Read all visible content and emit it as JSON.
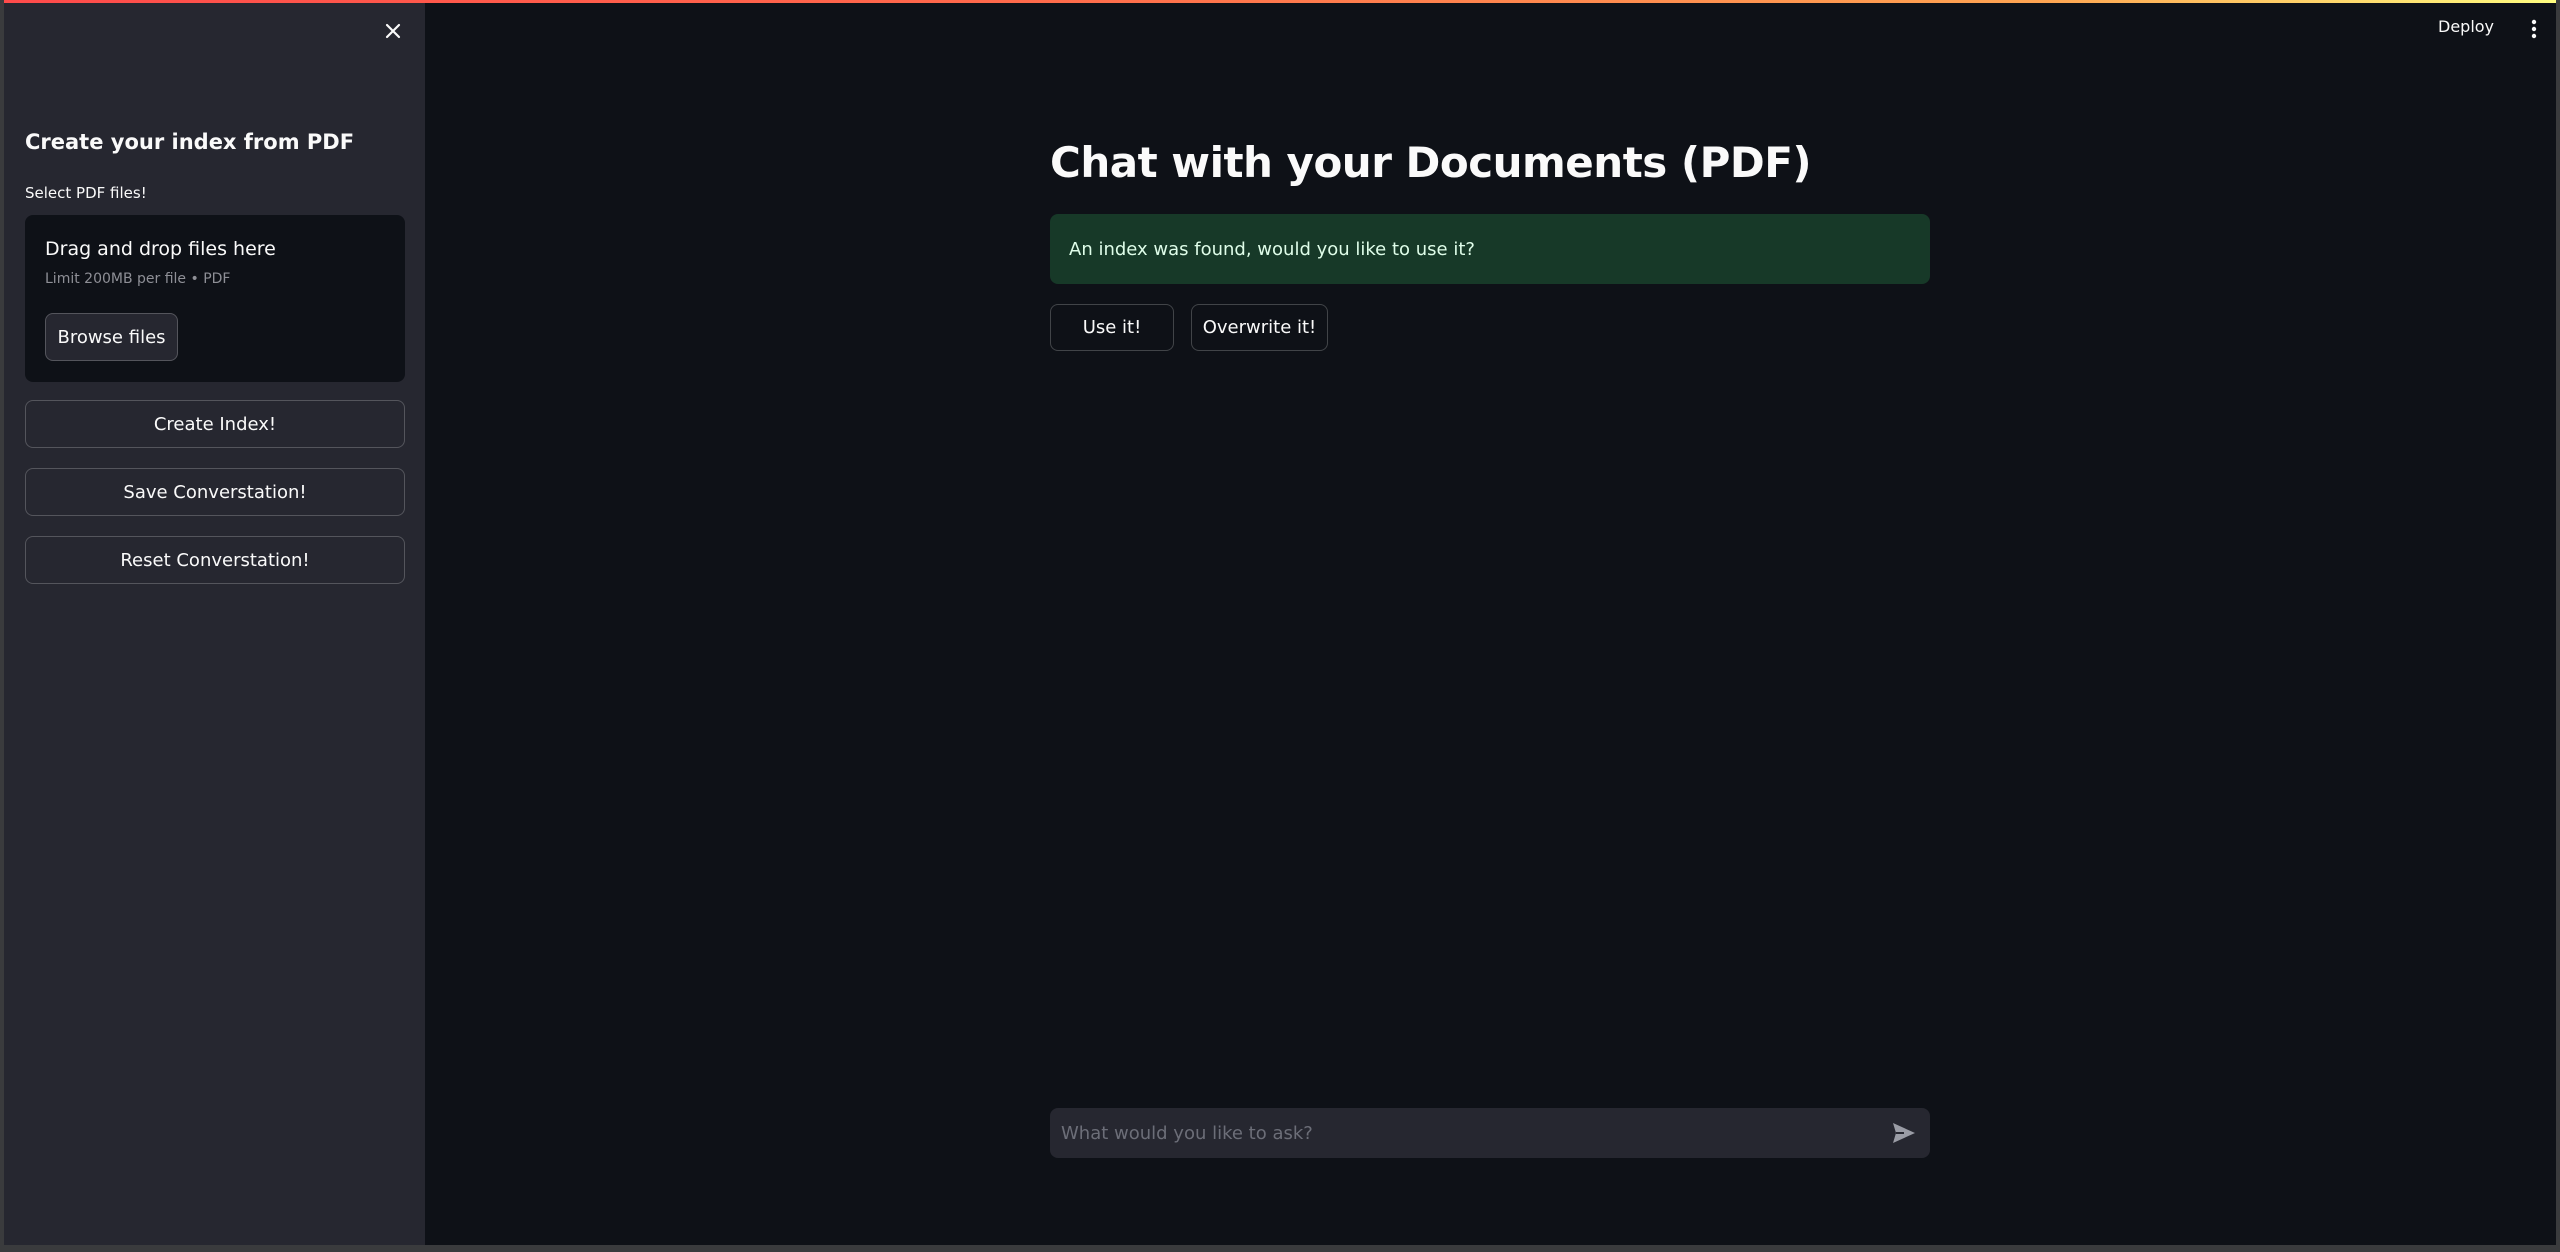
{
  "header": {
    "deploy_label": "Deploy"
  },
  "sidebar": {
    "title": "Create your index from PDF",
    "uploader_label": "Select PDF files!",
    "dropzone": {
      "title": "Drag and drop files here",
      "limit": "Limit 200MB per file • PDF",
      "browse_label": "Browse files"
    },
    "buttons": {
      "create_index": "Create Index!",
      "save_conversation": "Save Converstation!",
      "reset_conversation": "Reset Converstation!"
    }
  },
  "main": {
    "title": "Chat with your Documents (PDF)",
    "alert": "An index was found, would you like to use it?",
    "use_button": "Use it!",
    "overwrite_button": "Overwrite it!",
    "chat_placeholder": "What would you like to ask?"
  },
  "colors": {
    "background": "#0e1117",
    "sidebar": "#262730",
    "success_bg": "#173928",
    "text": "#fafafa"
  }
}
